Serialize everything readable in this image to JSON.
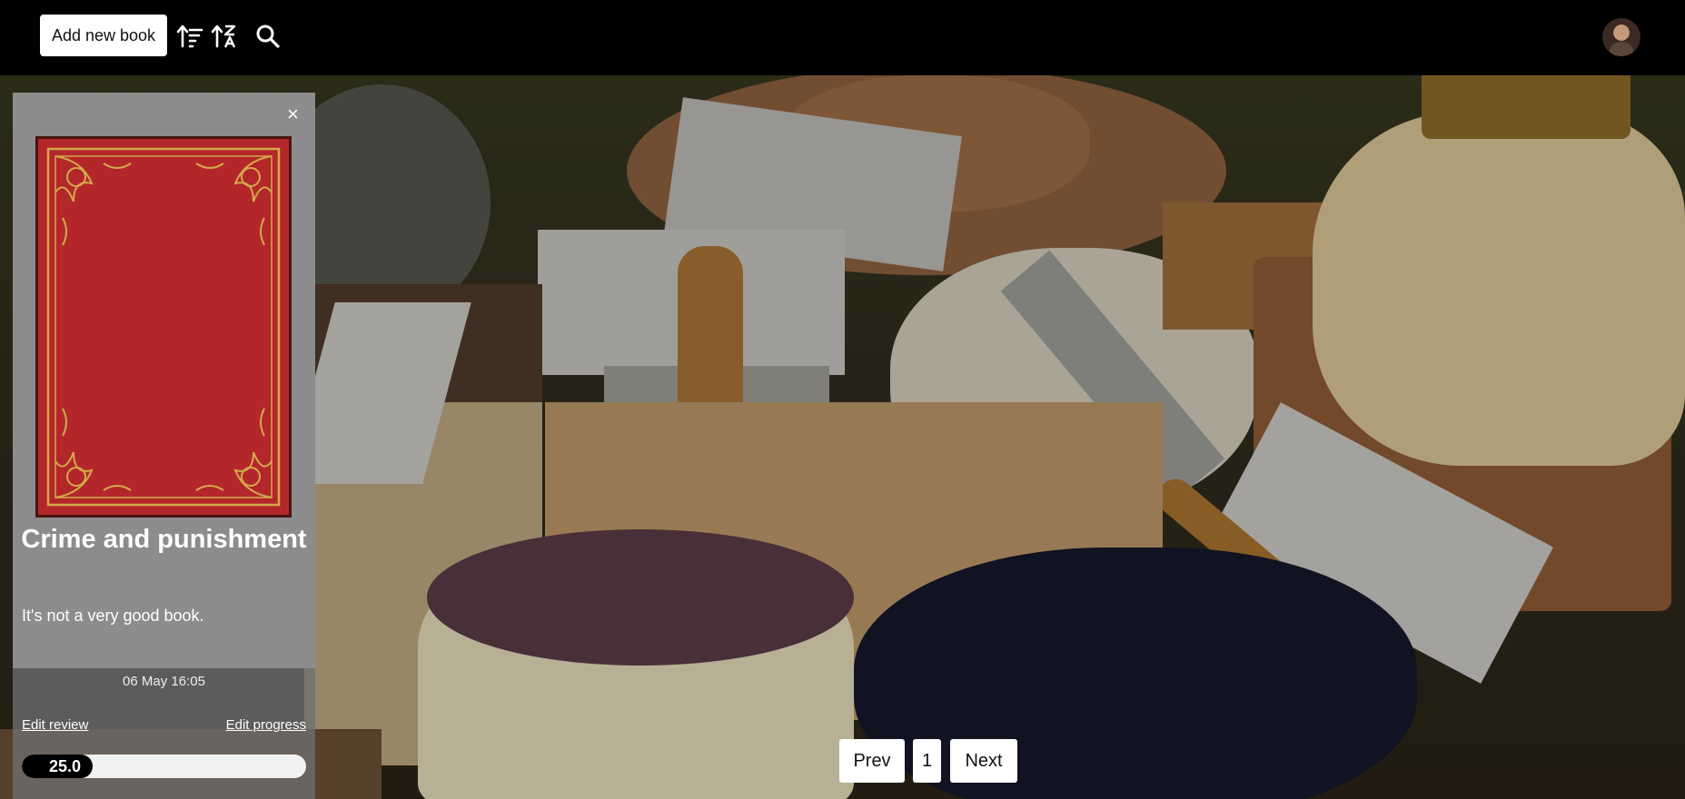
{
  "toolbar": {
    "add_label": "Add new book",
    "icons": [
      "sort-desc-icon",
      "sort-alpha-icon",
      "search-icon"
    ]
  },
  "card": {
    "close_label": "×",
    "title": "Crime and punishment",
    "review": "It's not a very good book.",
    "date": "06 May 16:05",
    "edit_review_label": "Edit review",
    "edit_progress_label": "Edit progress",
    "progress_value": 25.0,
    "progress_text": "25.0"
  },
  "pagination": {
    "prev_label": "Prev",
    "page": "1",
    "next_label": "Next"
  },
  "colors": {
    "topbar": "#000000",
    "card": "#8c8c8c",
    "book_cover": "#b3272a",
    "book_ornament": "#d4a94a"
  }
}
